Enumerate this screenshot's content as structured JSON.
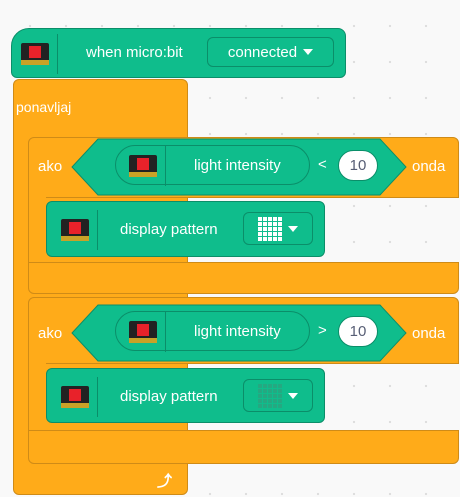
{
  "hat": {
    "label": "when micro:bit",
    "dropdown": "connected"
  },
  "loop": {
    "label": "ponavljaj"
  },
  "if1": {
    "ako": "ako",
    "onda": "onda",
    "reporter": "light intensity",
    "operator": "<",
    "value": "10",
    "action": "display pattern"
  },
  "if2": {
    "ako": "ako",
    "onda": "onda",
    "reporter": "light intensity",
    "operator": ">",
    "value": "10",
    "action": "display pattern"
  },
  "icons": {
    "microbit": "microbit-icon",
    "pattern_full": "pattern-all-on-icon",
    "pattern_empty": "pattern-all-off-icon",
    "loop_arrow": "loop-arrow-icon"
  },
  "colors": {
    "events_green": "#0fbd8c",
    "control_orange": "#ffab19"
  }
}
